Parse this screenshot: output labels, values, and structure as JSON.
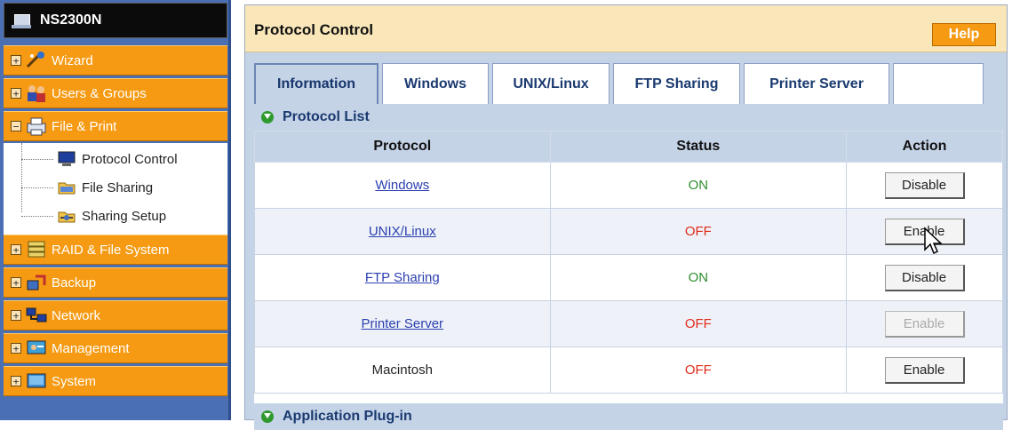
{
  "sidebar": {
    "title": "NS2300N",
    "items": [
      {
        "label": "Wizard"
      },
      {
        "label": "Users & Groups"
      },
      {
        "label": "File & Print"
      },
      {
        "label": "RAID & File System"
      },
      {
        "label": "Backup"
      },
      {
        "label": "Network"
      },
      {
        "label": "Management"
      },
      {
        "label": "System"
      }
    ],
    "subitems": [
      {
        "label": "Protocol Control"
      },
      {
        "label": "File Sharing"
      },
      {
        "label": "Sharing Setup"
      }
    ]
  },
  "header": {
    "title": "Protocol Control",
    "help": "Help"
  },
  "tabs": [
    {
      "label": "Information"
    },
    {
      "label": "Windows"
    },
    {
      "label": "UNIX/Linux"
    },
    {
      "label": "FTP Sharing"
    },
    {
      "label": "Printer Server"
    }
  ],
  "section": {
    "protocol_list": "Protocol List",
    "application_plugin": "Application Plug-in"
  },
  "table": {
    "headers": [
      "Protocol",
      "Status",
      "Action"
    ],
    "rows": [
      {
        "protocol": "Windows",
        "status": "ON",
        "action": "Disable"
      },
      {
        "protocol": "UNIX/Linux",
        "status": "OFF",
        "action": "Enable"
      },
      {
        "protocol": "FTP Sharing",
        "status": "ON",
        "action": "Disable"
      },
      {
        "protocol": "Printer Server",
        "status": "OFF",
        "action": "Enable"
      },
      {
        "protocol": "Macintosh",
        "status": "OFF",
        "action": "Enable"
      }
    ]
  },
  "colors": {
    "sidebar_orange": "#f59a12",
    "sidebar_blue": "#4a6fb3",
    "header_beige": "#f9e7ba",
    "status_on": "#2f8f2f",
    "status_off": "#e02a1a",
    "link_blue": "#2b3fb0"
  }
}
